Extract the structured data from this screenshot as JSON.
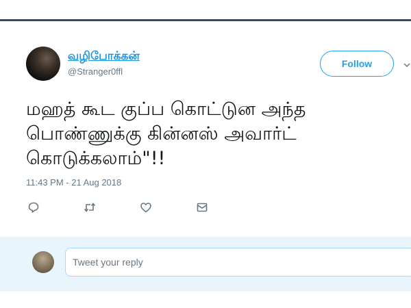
{
  "tweet": {
    "display_name": "வழிபோக்கன்",
    "handle": "@Stranger0ffl",
    "follow_label": "Follow",
    "text": "மஹத் கூட குப்ப கொட்டுன அந்த\nபொண்ணுக்கு கின்னஸ் அவார்ட்\nகொடுக்கலாம்\"!!",
    "timestamp": "11:43 PM - 21 Aug 2018",
    "icons": {
      "reply": "reply-icon",
      "retweet": "retweet-icon",
      "like": "heart-icon",
      "dm": "envelope-icon",
      "menu": "chevron-down-icon"
    }
  },
  "reply": {
    "placeholder": "Tweet your reply"
  },
  "colors": {
    "link": "#1b95e0",
    "accent": "#1da1f2",
    "muted": "#657786",
    "reply_bg": "#e8f5fd"
  }
}
